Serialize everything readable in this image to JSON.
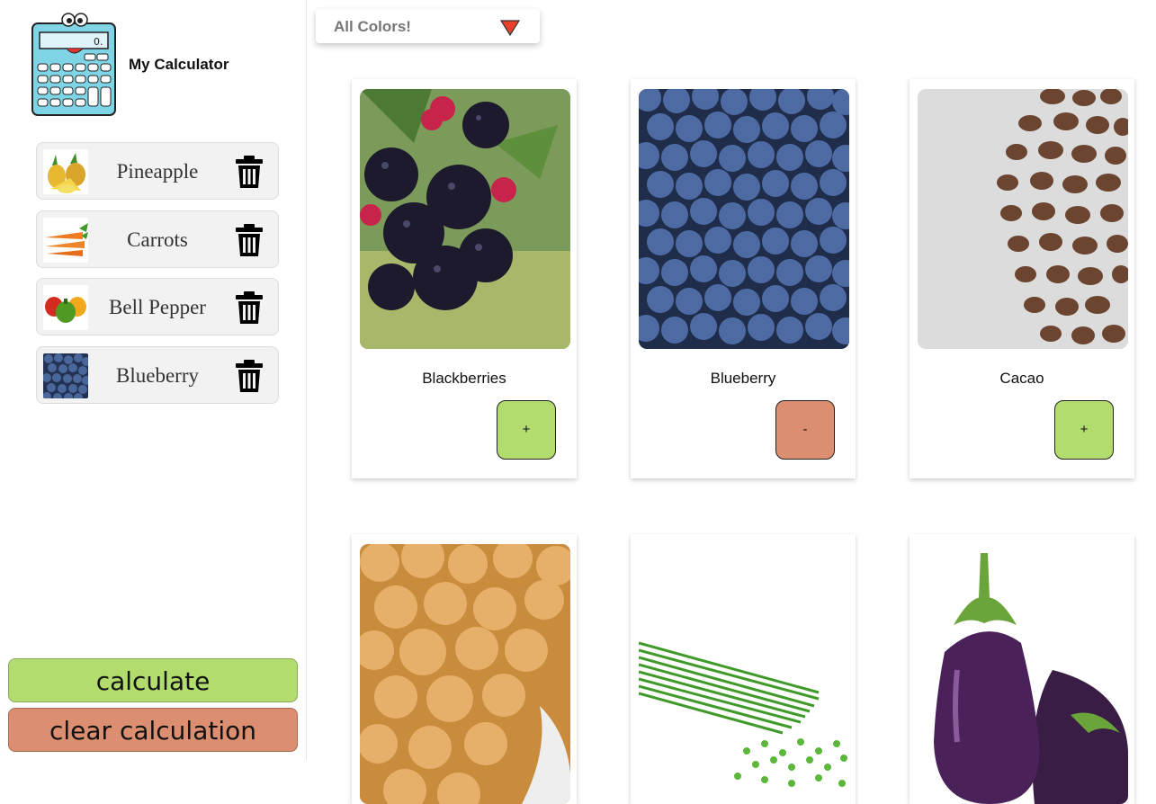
{
  "app": {
    "title": "My Calculator"
  },
  "selected_items": [
    {
      "label": "Pineapple"
    },
    {
      "label": "Carrots"
    },
    {
      "label": "Bell Pepper"
    },
    {
      "label": "Blueberry"
    }
  ],
  "actions": {
    "calculate": "calculate",
    "clear": "clear calculation"
  },
  "filter": {
    "label": "All Colors!"
  },
  "products": [
    {
      "name": "Blackberries",
      "button": "+",
      "state": "add"
    },
    {
      "name": "Blueberry",
      "button": "-",
      "state": "remove"
    },
    {
      "name": "Cacao",
      "button": "+",
      "state": "add"
    },
    {
      "name": ""
    },
    {
      "name": ""
    },
    {
      "name": ""
    }
  ],
  "colors": {
    "add": "#b2dc6e",
    "remove": "#db8f70",
    "caret": "#e8402a"
  },
  "icons": {
    "logo": "calculator-mascot-icon",
    "delete": "trash-icon",
    "dropdown": "triangle-down-icon"
  }
}
